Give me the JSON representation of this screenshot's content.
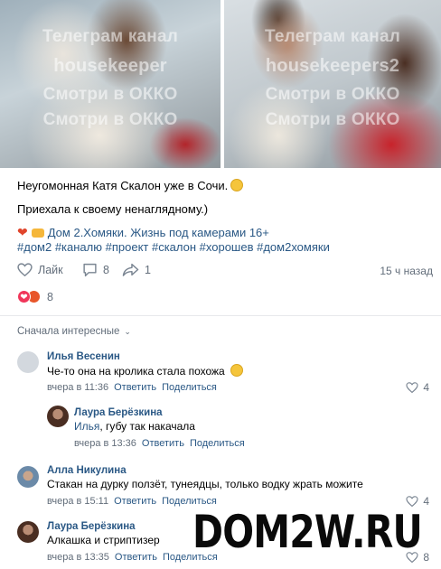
{
  "photos": {
    "watermark_line1": "Телеграм канал",
    "watermark_line2_left": "housekeeper",
    "watermark_line2_right": "housekeepers2",
    "watermark_line3": "Смотри в ОККО",
    "watermark_line4": "Смотри в ОККО"
  },
  "post": {
    "line1": "Неугомонная Катя Скалон уже в Сочи.",
    "line2": "Приехала к своему ненаглядному.)",
    "group_link": "Дом 2.Хомяки. Жизнь под камерами 16+",
    "hashtags": "#дом2 #каналю #проект #скалон #хорошев #дом2хомяки"
  },
  "actions": {
    "like_label": "Лайк",
    "comments_count": "8",
    "shares_count": "1",
    "time_ago": "15 ч назад"
  },
  "reactions": {
    "count": "8"
  },
  "comments_sort": "Сначала интересные",
  "comments": [
    {
      "name": "Илья Весенин",
      "text": "Че-то она на кролика стала похожа",
      "emoji": "😂",
      "time": "вчера в 11:36",
      "reply": "Ответить",
      "share": "Поделиться",
      "likes": "4"
    },
    {
      "name": "Лаура Берёзкина",
      "reply_to": "Илья",
      "text": ", губу так накачала",
      "time": "вчера в 13:36",
      "reply": "Ответить",
      "share": "Поделиться"
    },
    {
      "name": "Алла Никулина",
      "text": "Стакан на дурку ползёт, тунеядцы, только водку жрать можите",
      "time": "вчера в 15:11",
      "reply": "Ответить",
      "share": "Поделиться",
      "likes": "4"
    },
    {
      "name": "Лаура Берёзкина",
      "text": "Алкашка и стриптизер",
      "time": "вчера в 13:35",
      "reply": "Ответить",
      "share": "Поделиться",
      "likes": "8"
    }
  ],
  "site_watermark": "DOM2W.RU",
  "colors": {
    "link": "#2a5885",
    "meta": "#626d7a",
    "heart": "#f0365a"
  }
}
